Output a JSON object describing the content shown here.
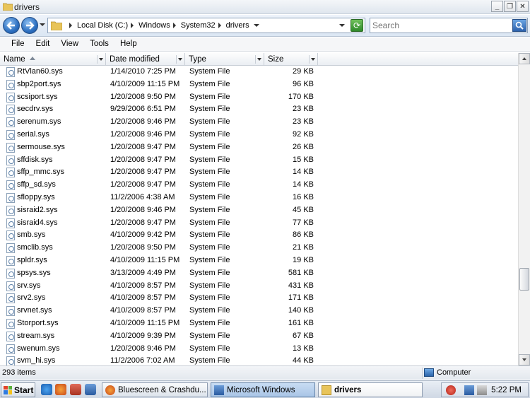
{
  "window": {
    "title": "drivers",
    "minimize_label": "_",
    "restore_label": "❐",
    "close_label": "✕"
  },
  "address": {
    "crumbs": [
      "Local Disk (C:)",
      "Windows",
      "System32",
      "drivers"
    ],
    "search_placeholder": "Search"
  },
  "menu": [
    "File",
    "Edit",
    "View",
    "Tools",
    "Help"
  ],
  "columns": {
    "name": "Name",
    "date": "Date modified",
    "type": "Type",
    "size": "Size"
  },
  "files": [
    {
      "name": "RtVlan60.sys",
      "date": "1/14/2010 7:25 PM",
      "type": "System File",
      "size": "29 KB"
    },
    {
      "name": "sbp2port.sys",
      "date": "4/10/2009 11:15 PM",
      "type": "System File",
      "size": "96 KB"
    },
    {
      "name": "scsiport.sys",
      "date": "1/20/2008 9:50 PM",
      "type": "System File",
      "size": "170 KB"
    },
    {
      "name": "secdrv.sys",
      "date": "9/29/2006 6:51 PM",
      "type": "System File",
      "size": "23 KB"
    },
    {
      "name": "serenum.sys",
      "date": "1/20/2008 9:46 PM",
      "type": "System File",
      "size": "23 KB"
    },
    {
      "name": "serial.sys",
      "date": "1/20/2008 9:46 PM",
      "type": "System File",
      "size": "92 KB"
    },
    {
      "name": "sermouse.sys",
      "date": "1/20/2008 9:47 PM",
      "type": "System File",
      "size": "26 KB"
    },
    {
      "name": "sffdisk.sys",
      "date": "1/20/2008 9:47 PM",
      "type": "System File",
      "size": "15 KB"
    },
    {
      "name": "sffp_mmc.sys",
      "date": "1/20/2008 9:47 PM",
      "type": "System File",
      "size": "14 KB"
    },
    {
      "name": "sffp_sd.sys",
      "date": "1/20/2008 9:47 PM",
      "type": "System File",
      "size": "14 KB"
    },
    {
      "name": "sfloppy.sys",
      "date": "11/2/2006 4:38 AM",
      "type": "System File",
      "size": "16 KB"
    },
    {
      "name": "sisraid2.sys",
      "date": "1/20/2008 9:46 PM",
      "type": "System File",
      "size": "45 KB"
    },
    {
      "name": "sisraid4.sys",
      "date": "1/20/2008 9:47 PM",
      "type": "System File",
      "size": "77 KB"
    },
    {
      "name": "smb.sys",
      "date": "4/10/2009 9:42 PM",
      "type": "System File",
      "size": "86 KB"
    },
    {
      "name": "smclib.sys",
      "date": "1/20/2008 9:50 PM",
      "type": "System File",
      "size": "21 KB"
    },
    {
      "name": "spldr.sys",
      "date": "4/10/2009 11:15 PM",
      "type": "System File",
      "size": "19 KB"
    },
    {
      "name": "spsys.sys",
      "date": "3/13/2009 4:49 PM",
      "type": "System File",
      "size": "581 KB"
    },
    {
      "name": "srv.sys",
      "date": "4/10/2009 8:57 PM",
      "type": "System File",
      "size": "431 KB"
    },
    {
      "name": "srv2.sys",
      "date": "4/10/2009 8:57 PM",
      "type": "System File",
      "size": "171 KB"
    },
    {
      "name": "srvnet.sys",
      "date": "4/10/2009 8:57 PM",
      "type": "System File",
      "size": "140 KB"
    },
    {
      "name": "Storport.sys",
      "date": "4/10/2009 11:15 PM",
      "type": "System File",
      "size": "161 KB"
    },
    {
      "name": "stream.sys",
      "date": "4/10/2009 9:39 PM",
      "type": "System File",
      "size": "67 KB"
    },
    {
      "name": "swenum.sys",
      "date": "1/20/2008 9:46 PM",
      "type": "System File",
      "size": "13 KB"
    },
    {
      "name": "svm_hi.sys",
      "date": "11/2/2006 7:02 AM",
      "type": "System File",
      "size": "44 KB"
    }
  ],
  "status": {
    "item_count": "293 items",
    "location": "Computer"
  },
  "taskbar": {
    "start_label": "Start",
    "tasks": [
      {
        "label": "Bluescreen & Crashdu...",
        "icon": "firefox-icon"
      },
      {
        "label": "Microsoft Windows",
        "icon": "window-icon"
      },
      {
        "label": "drivers",
        "icon": "folder-icon"
      }
    ],
    "clock": "5:22 PM"
  },
  "colors": {
    "accent": "#2c6fc0",
    "folder": "#e8c45a",
    "taskbar": "#cfd8e4"
  }
}
